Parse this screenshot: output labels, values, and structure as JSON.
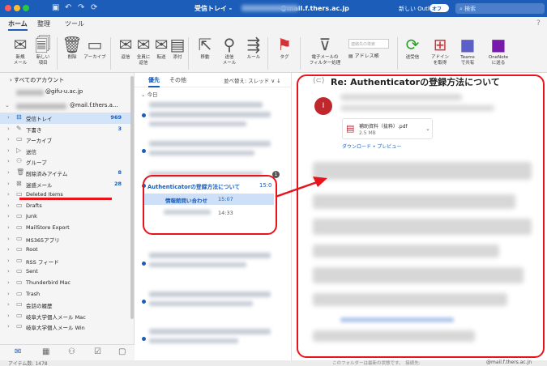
{
  "titlebar": {
    "title": "受信トレイ -",
    "email": "@mail.f.thers.ac.jp",
    "new_outlook_label": "新しい Outlook",
    "toggle_label": "オフ",
    "search_placeholder": "検索"
  },
  "ribbon_tabs": [
    "ホーム",
    "整理",
    "ツール"
  ],
  "ribbon": {
    "buttons": [
      {
        "label": "新規\nメール",
        "icon": "new-mail-icon"
      },
      {
        "label": "新しい\n項目",
        "icon": "new-item-icon"
      },
      {
        "label": "削除",
        "icon": "delete-icon"
      },
      {
        "label": "アーカイブ",
        "icon": "archive-icon"
      },
      {
        "label": "返信",
        "icon": "reply-icon"
      },
      {
        "label": "全員に\n返信",
        "icon": "reply-all-icon"
      },
      {
        "label": "転送",
        "icon": "forward-icon"
      },
      {
        "label": "添付",
        "icon": "attach-icon"
      },
      {
        "label": "移動",
        "icon": "move-icon"
      },
      {
        "label": "送信\nメール",
        "icon": "send-mail-icon"
      },
      {
        "label": "ルール",
        "icon": "rules-icon"
      },
      {
        "label": "タグ",
        "icon": "tag-icon"
      },
      {
        "label": "電子メールの\nフィルター処理",
        "icon": "filter-icon"
      },
      {
        "label": "送受信",
        "icon": "send-receive-icon"
      },
      {
        "label": "アドイン\nを取得",
        "icon": "get-addins-icon"
      },
      {
        "label": "Teams\nで共有",
        "icon": "teams-icon"
      },
      {
        "label": "OneNote\nに送る",
        "icon": "onenote-icon"
      }
    ],
    "find_contact_placeholder": "連絡先の検索",
    "address_book": "アドレス帳"
  },
  "folders": {
    "all_accounts": "すべてのアカウント",
    "account1": "@gifu-u.ac.jp",
    "account2": "@mail.f.thers.a...",
    "items": [
      {
        "name": "受信トレイ",
        "count": "969",
        "icon": "inbox-icon",
        "selected": true
      },
      {
        "name": "下書き",
        "count": "3",
        "icon": "drafts-icon"
      },
      {
        "name": "アーカイブ",
        "count": "",
        "icon": "archive-icon"
      },
      {
        "name": "送信",
        "count": "",
        "icon": "sent-icon"
      },
      {
        "name": "グループ",
        "count": "",
        "icon": "group-icon"
      },
      {
        "name": "削除済みアイテム",
        "count": "8",
        "icon": "trash-icon"
      },
      {
        "name": "迷惑メール",
        "count": "28",
        "icon": "junk-icon"
      },
      {
        "name": "Deleted Items",
        "count": "",
        "icon": "folder-icon"
      },
      {
        "name": "Drafts",
        "count": "",
        "icon": "folder-icon"
      },
      {
        "name": "Junk",
        "count": "",
        "icon": "folder-icon"
      },
      {
        "name": "MailStore Export",
        "count": "",
        "icon": "folder-icon"
      },
      {
        "name": "MS365アプリ",
        "count": "",
        "icon": "folder-icon"
      },
      {
        "name": "Root",
        "count": "",
        "icon": "folder-icon"
      },
      {
        "name": "RSS フィード",
        "count": "",
        "icon": "folder-icon"
      },
      {
        "name": "Sent",
        "count": "",
        "icon": "folder-icon"
      },
      {
        "name": "Thunderbird Mac",
        "count": "",
        "icon": "folder-icon"
      },
      {
        "name": "Trash",
        "count": "",
        "icon": "folder-icon"
      },
      {
        "name": "会話の履歴",
        "count": "",
        "icon": "folder-icon"
      },
      {
        "name": "岐阜大学個人メール Mac",
        "count": "",
        "icon": "folder-icon"
      },
      {
        "name": "岐阜大学個人メール Win",
        "count": "",
        "icon": "folder-icon"
      }
    ]
  },
  "message_list": {
    "tab_focused": "優先",
    "tab_other": "その他",
    "sort_label": "並べ替え: スレッド ∨ ↓",
    "group_today": "今日",
    "thread_count": "1",
    "thread_subject": "Authenticatorの登録方法について",
    "thread_time": "15:0",
    "child1_name": "情報館問い合わせ",
    "child1_time": "15:07",
    "child2_time": "14:33"
  },
  "reading_pane": {
    "subject": "Re: Authenticatorの登録方法について",
    "avatar_initial": "I",
    "attachment_name": "補助資料（抜粋）.pdf",
    "attachment_size": "2.5 MB",
    "download_links": "ダウンロード • プレビュー"
  },
  "status": {
    "item_count": "アイテム数: 1478",
    "middle": "このフォルダーは最新の状態です。　接続先:",
    "email": "@mail.f.thers.ac.jn"
  },
  "colors": {
    "accent": "#1b5db8",
    "annotation": "#e8141c"
  }
}
